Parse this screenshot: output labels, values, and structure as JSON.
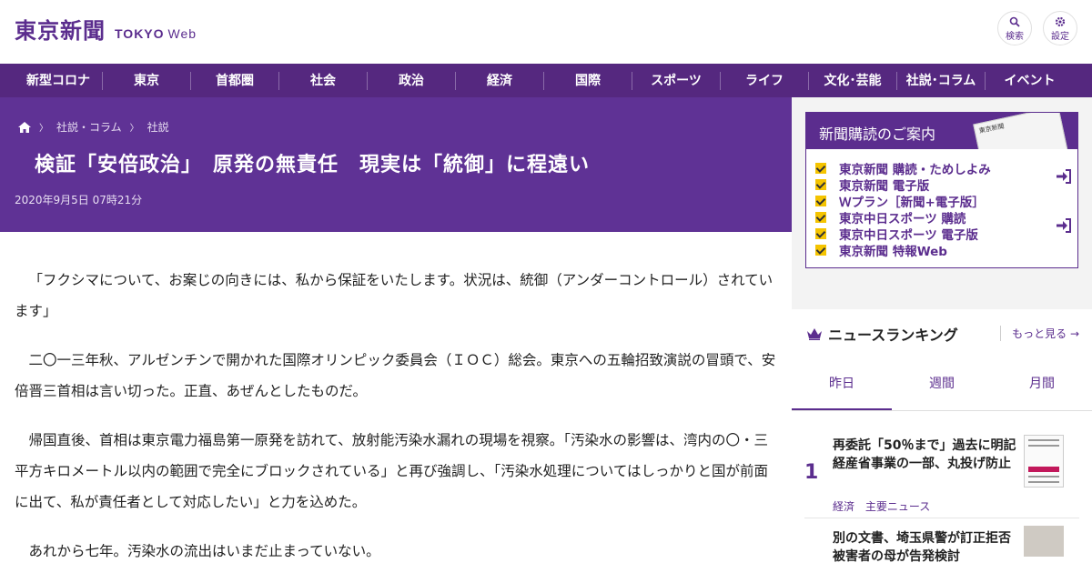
{
  "header": {
    "logo_jp": "東京新聞",
    "logo_en": "TOKYO",
    "logo_web": "Web",
    "search_label": "検索",
    "settings_label": "設定"
  },
  "nav": {
    "items": [
      "新型コロナ",
      "東京",
      "首都圏",
      "社会",
      "政治",
      "経済",
      "国際",
      "スポーツ",
      "ライフ",
      "文化･芸能",
      "社説･コラム",
      "イベント"
    ]
  },
  "article": {
    "breadcrumb": [
      "社説・コラム",
      "社説"
    ],
    "title": "検証「安倍政治」　原発の無責任　現実は「統御」に程遠い",
    "date": "2020年9月5日 07時21分",
    "paragraphs": [
      "「フクシマについて、お案じの向きには、私から保証をいたします。状況は、統御（アンダーコントロール）されています」",
      "二〇一三年秋、アルゼンチンで開かれた国際オリンピック委員会（ＩＯＣ）総会。東京への五輪招致演説の冒頭で、安倍晋三首相は言い切った。正直、あぜんとしたものだ。",
      "帰国直後、首相は東京電力福島第一原発を訪れて、放射能汚染水漏れの現場を視察。「汚染水の影響は、湾内の〇・三平方キロメートル以内の範囲で完全にブロックされている」と再び強調し、「汚染水処理についてはしっかりと国が前面に出て、私が責任者として対応したい」と力を込めた。",
      "あれから七年。汚染水の流出はいまだ止まっていない。"
    ]
  },
  "promo": {
    "title": "新聞購読のご案内",
    "paper_text": "東京新聞",
    "items": [
      "東京新聞 購読・ためしよみ",
      "東京新聞 電子版",
      "Ｗプラン［新聞+電子版］",
      "東京中日スポーツ 購読",
      "東京中日スポーツ 電子版",
      "東京新聞 特報Web"
    ],
    "accent": "#f5c400"
  },
  "ranking": {
    "title": "ニュースランキング",
    "more": "もっと見る",
    "tabs": [
      "昨日",
      "週間",
      "月間"
    ],
    "items": [
      {
        "rank": "1",
        "title": "再委託「50％まで」過去に明記　経産省事業の一部、丸投げ防止",
        "tags": [
          "経済",
          "主要ニュース"
        ]
      },
      {
        "title": "別の文書、埼玉県警が訂正拒否　被害者の母が告発検討"
      }
    ]
  },
  "colors": {
    "brand": "#5b2d8e",
    "nav_bg": "#55287f",
    "article_header_bg": "#5f3295"
  }
}
